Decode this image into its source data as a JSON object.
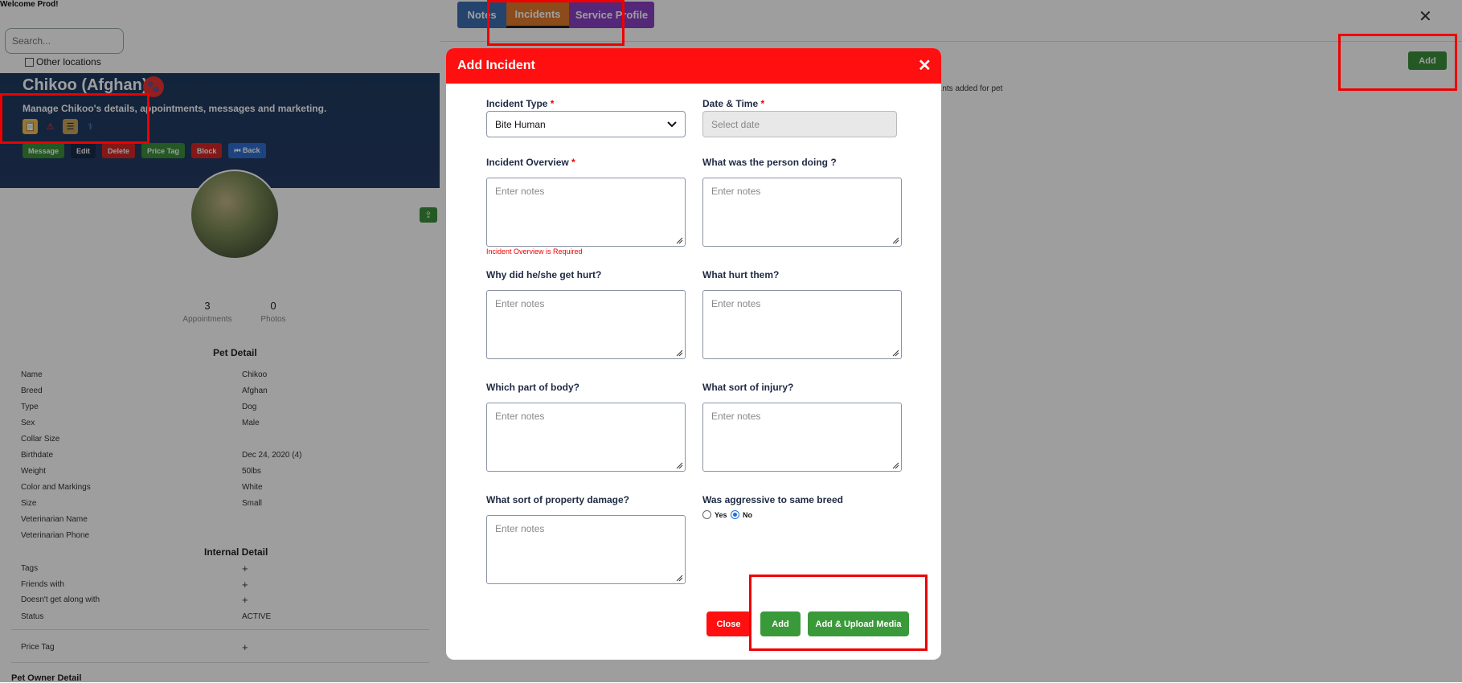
{
  "left": {
    "welcome": "Welcome Prod!",
    "search_placeholder": "Search...",
    "other_locations": "Other locations",
    "pet_title": "Chikoo (Afghan)",
    "manage_text": "Manage Chikoo's details, appointments, messages and marketing.",
    "actions": [
      "Message",
      "Edit",
      "Delete",
      "Price Tag",
      "Block",
      "⏮ Back"
    ],
    "stats": {
      "appointments_count": "3",
      "appointments_label": "Appointments",
      "photos_count": "0",
      "photos_label": "Photos"
    },
    "pet_detail_title": "Pet Detail",
    "pet_detail": [
      {
        "k": "Name",
        "v": "Chikoo"
      },
      {
        "k": "Breed",
        "v": "Afghan"
      },
      {
        "k": "Type",
        "v": "Dog"
      },
      {
        "k": "Sex",
        "v": "Male"
      },
      {
        "k": "Collar Size",
        "v": ""
      },
      {
        "k": "Birthdate",
        "v": "Dec 24, 2020  (4)"
      },
      {
        "k": "Weight",
        "v": "50lbs"
      },
      {
        "k": "Color and Markings",
        "v": "White"
      },
      {
        "k": "Size",
        "v": "Small"
      },
      {
        "k": "Veterinarian Name",
        "v": ""
      },
      {
        "k": "Veterinarian Phone",
        "v": ""
      }
    ],
    "internal_detail_title": "Internal Detail",
    "internal_detail": [
      {
        "k": "Tags",
        "v": "+"
      },
      {
        "k": "Friends with",
        "v": "+"
      },
      {
        "k": "Doesn't get along with",
        "v": "+"
      },
      {
        "k": "Status",
        "v": "ACTIVE"
      }
    ],
    "price_tag": {
      "k": "Price Tag",
      "v": "+"
    },
    "owner_title": "Pet Owner Detail"
  },
  "tabs": [
    "Notes",
    "Incidents",
    "Service Profile"
  ],
  "right": {
    "add_label": "Add",
    "close_glyph": "✕",
    "notes_text": "...nts added for pet"
  },
  "modal": {
    "title": "Add Incident",
    "close_glyph": "✕",
    "incident_type_label": "Incident Type",
    "incident_type_value": "Bite Human",
    "date_label": "Date & Time",
    "date_placeholder": "Select date",
    "overview_label": "Incident Overview",
    "overview_error": "Incident Overview is Required",
    "person_doing_label": "What was the person doing ?",
    "why_hurt_label": "Why did he/she get hurt?",
    "what_hurt_label": "What hurt them?",
    "body_part_label": "Which part of body?",
    "injury_label": "What sort of injury?",
    "property_label": "What sort of property damage?",
    "aggressive_label": "Was aggressive to same breed",
    "yes_label": "Yes",
    "no_label": "No",
    "aggressive_selected": "No",
    "notes_placeholder": "Enter notes",
    "required_mark": "*",
    "close_btn": "Close",
    "add_btn": "Add",
    "add_upload_btn": "Add & Upload Media"
  },
  "colors": {
    "modal_header": "#ff0f0f",
    "green": "#3a8f3a",
    "notes_tab": "#3b6fb0",
    "incidents_tab": "#e07a2a",
    "service_tab": "#8a3fc4"
  }
}
